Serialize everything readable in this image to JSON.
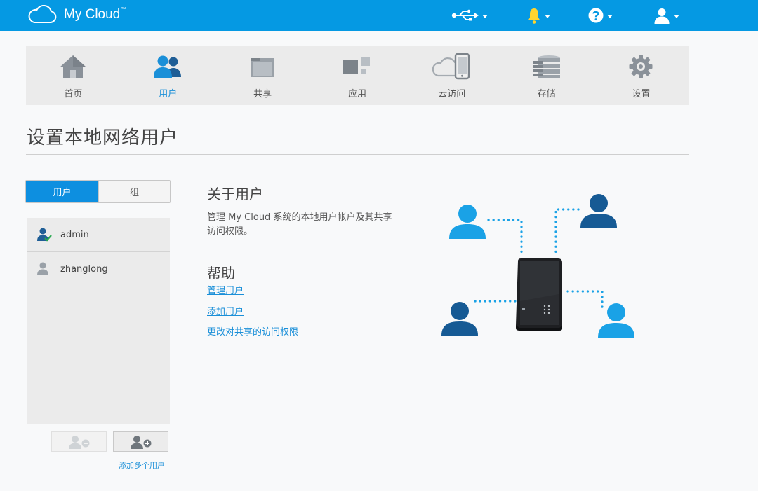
{
  "header": {
    "brand": "My Cloud",
    "brand_tm": "™",
    "icons": [
      "usb-icon",
      "bell-icon",
      "help-icon",
      "user-icon"
    ],
    "colors": {
      "bar": "#0599e3",
      "bell": "#ffd52e"
    }
  },
  "nav": {
    "items": [
      {
        "label": "首页",
        "icon": "home-icon",
        "active": false
      },
      {
        "label": "用户",
        "icon": "users-icon",
        "active": true
      },
      {
        "label": "共享",
        "icon": "share-folder-icon",
        "active": false
      },
      {
        "label": "应用",
        "icon": "apps-icon",
        "active": false
      },
      {
        "label": "云访问",
        "icon": "cloud-access-icon",
        "active": false
      },
      {
        "label": "存储",
        "icon": "storage-icon",
        "active": false
      },
      {
        "label": "设置",
        "icon": "gear-icon",
        "active": false
      }
    ],
    "accent": "#1a8fd8"
  },
  "page": {
    "title": "设置本地网络用户"
  },
  "tabs": {
    "users": "用户",
    "groups": "组"
  },
  "users": [
    {
      "name": "admin",
      "is_admin": true
    },
    {
      "name": "zhanglong",
      "is_admin": false
    }
  ],
  "actions": {
    "add_multiple": "添加多个用户"
  },
  "about": {
    "title": "关于用户",
    "description": "管理 My Cloud 系统的本地用户帐户及其共享访问权限。"
  },
  "help": {
    "title": "帮助",
    "links": [
      "管理用户",
      "添加用户",
      "更改对共享的访问权限"
    ]
  }
}
